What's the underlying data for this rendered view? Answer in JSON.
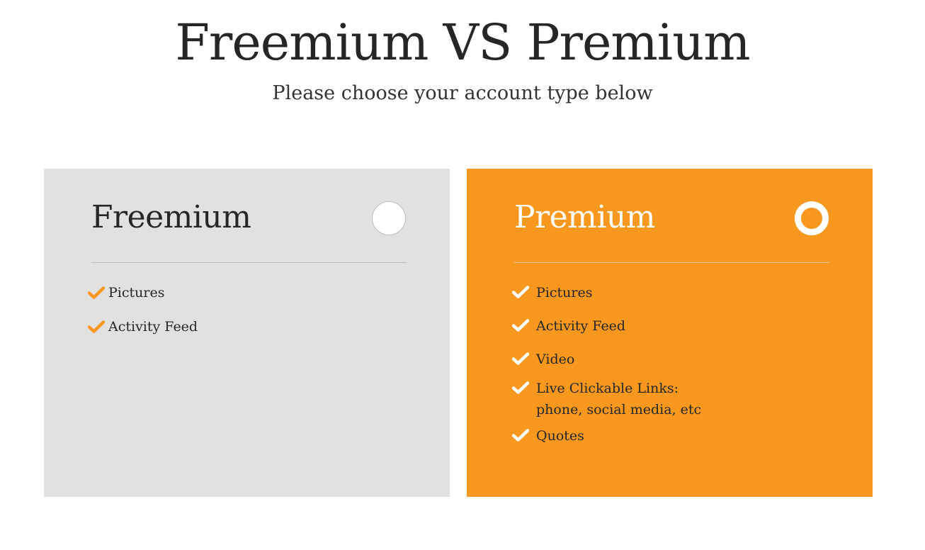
{
  "header": {
    "title": "Freemium VS Premium",
    "subtitle": "Please choose your account type below"
  },
  "plans": [
    {
      "name": "Freemium",
      "selected": false,
      "background": "#e1e1e1",
      "check_color": "#f8981f",
      "features": [
        "Pictures",
        "Activity Feed"
      ]
    },
    {
      "name": "Premium",
      "selected": true,
      "background": "#f8981f",
      "check_color": "#ffffff",
      "features": [
        "Pictures",
        "Activity Feed",
        "Video",
        "Live Clickable Links:",
        "phone, social media, etc",
        "Quotes"
      ]
    }
  ],
  "icons": {
    "check": "check-icon",
    "radio": "radio-icon"
  },
  "colors": {
    "accent": "#f8981f",
    "card_gray": "#e1e1e1",
    "text": "#262626"
  }
}
